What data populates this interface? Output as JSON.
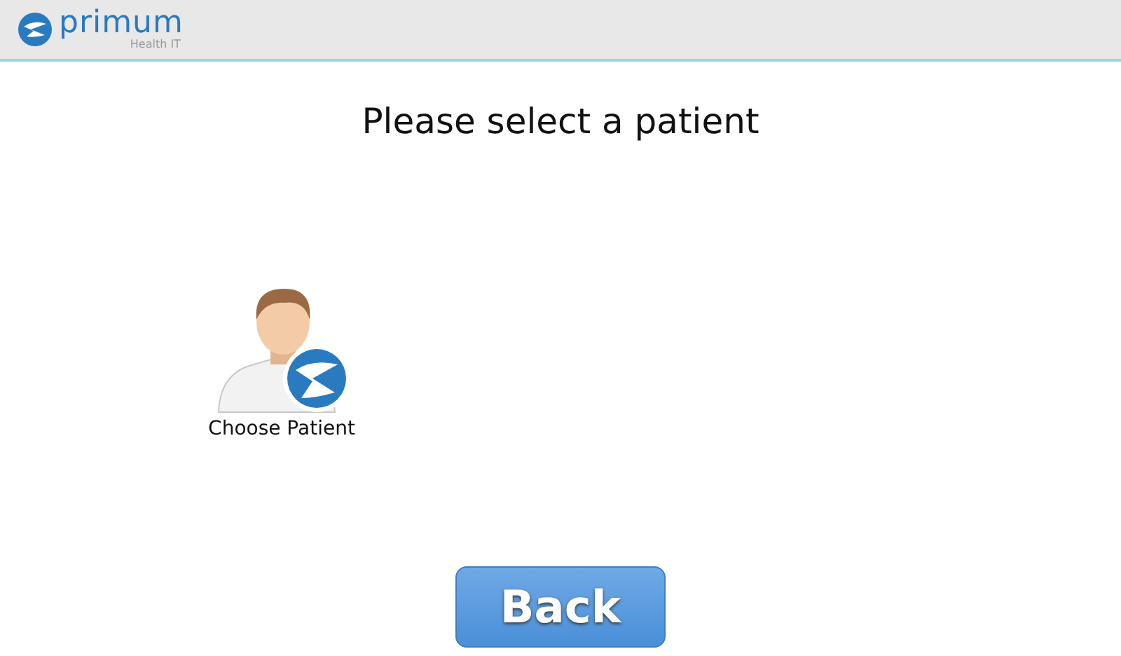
{
  "header": {
    "logo_name": "primum",
    "logo_tagline": "Health IT"
  },
  "title": "Please select a patient",
  "tiles": [
    {
      "label": "Choose Patient"
    }
  ],
  "back_button": "Back"
}
